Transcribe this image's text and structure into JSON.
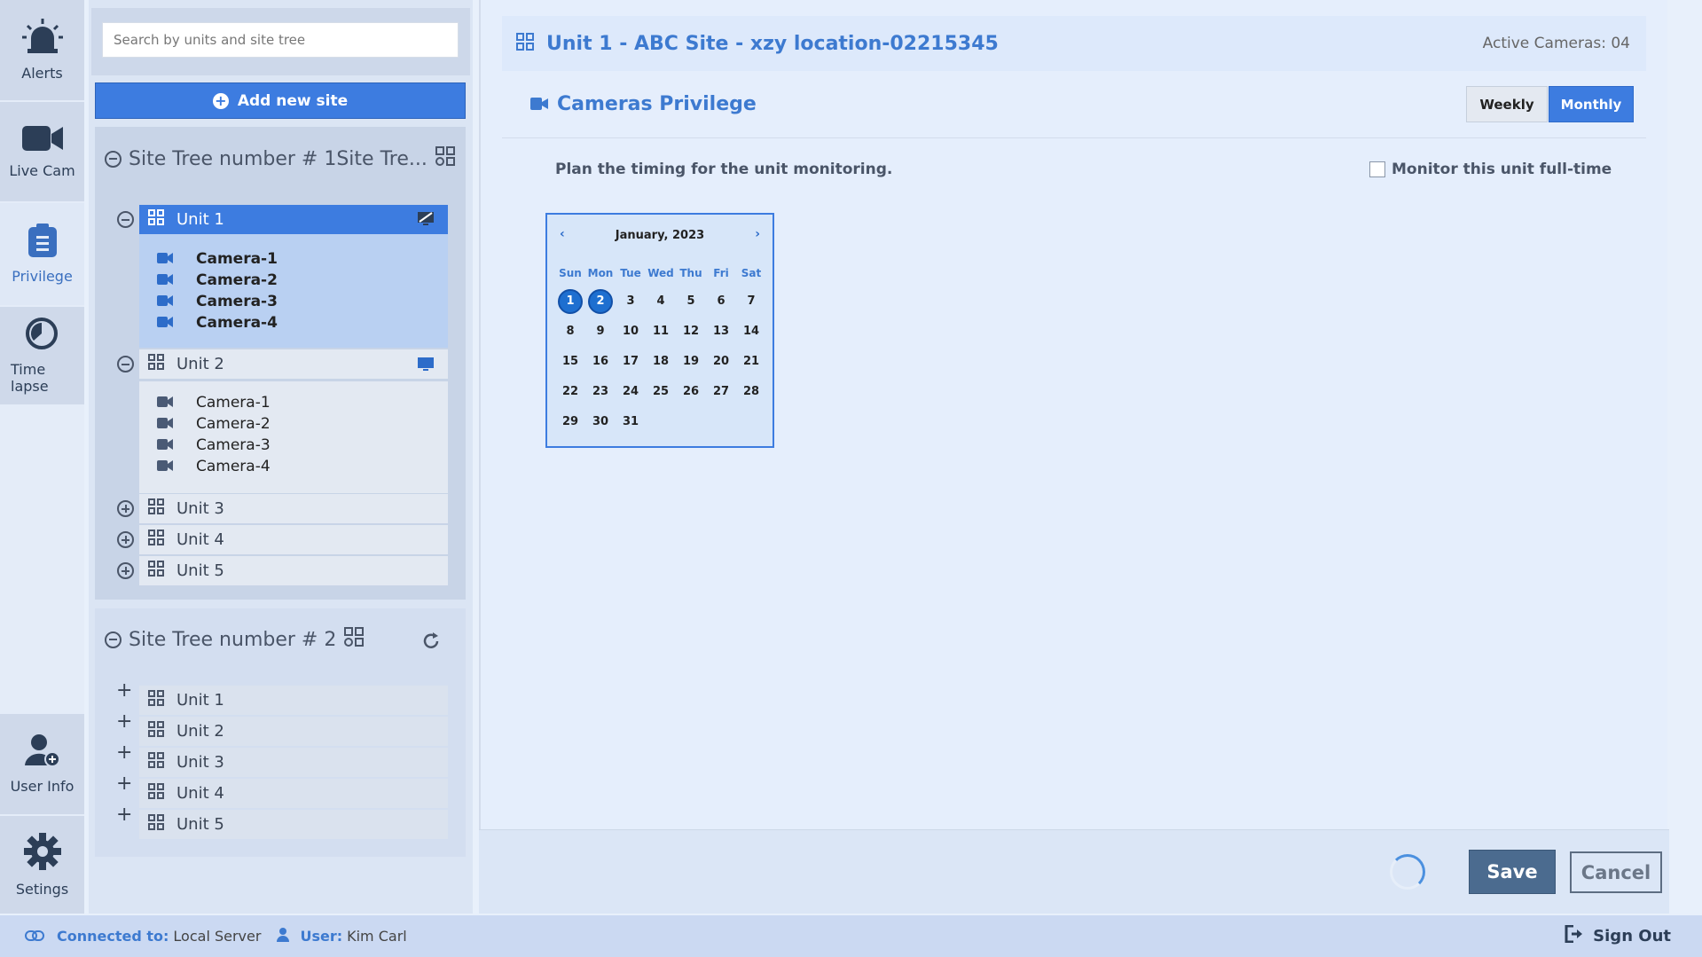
{
  "nav": {
    "alerts": "Alerts",
    "live_cam": "Live Cam",
    "privilege": "Privilege",
    "timelapse_1": "Time",
    "timelapse_2": "lapse",
    "user_info": "User Info",
    "settings": "Setings"
  },
  "sidebar": {
    "search_placeholder": "Search by units and site tree",
    "add_site_label": "Add new site",
    "tree1": {
      "title": "Site Tree number # 1Site Tre...",
      "units": [
        {
          "label": "Unit 1",
          "cameras": [
            "Camera-1",
            "Camera-2",
            "Camera-3",
            "Camera-4"
          ]
        },
        {
          "label": "Unit 2",
          "cameras": [
            "Camera-1",
            "Camera-2",
            "Camera-3",
            "Camera-4"
          ]
        },
        {
          "label": "Unit 3"
        },
        {
          "label": "Unit 4"
        },
        {
          "label": "Unit 5"
        }
      ]
    },
    "tree2": {
      "title": "Site Tree number # 2",
      "units": [
        {
          "label": "Unit 1"
        },
        {
          "label": "Unit 2"
        },
        {
          "label": "Unit 3"
        },
        {
          "label": "Unit 4"
        },
        {
          "label": "Unit 5"
        }
      ]
    }
  },
  "main": {
    "title": "Unit 1 - ABC Site - xzy location-02215345",
    "active_cameras": "Active Cameras: 04",
    "section_title": "Cameras Privilege",
    "weekly_label": "Weekly",
    "monthly_label": "Monthly",
    "plan_text": "Plan the timing for the unit monitoring.",
    "monitor_label": "Monitor this unit full-time",
    "calendar": {
      "month_label": "January, 2023",
      "prev": "‹",
      "next": "›",
      "weekdays": [
        "Sun",
        "Mon",
        "Tue",
        "Wed",
        "Thu",
        "Fri",
        "Sat"
      ],
      "days": [
        "1",
        "2",
        "3",
        "4",
        "5",
        "6",
        "7",
        "8",
        "9",
        "10",
        "11",
        "12",
        "13",
        "14",
        "15",
        "16",
        "17",
        "18",
        "19",
        "20",
        "21",
        "22",
        "23",
        "24",
        "25",
        "26",
        "27",
        "28",
        "29",
        "30",
        "31"
      ],
      "selected_days": [
        "1",
        "2"
      ]
    },
    "save_label": "Save",
    "cancel_label": "Cancel"
  },
  "status": {
    "connected_label": "Connected to:",
    "connected_value": "Local Server",
    "user_label": "User:",
    "user_value": "Kim Carl",
    "signout_label": "Sign Out"
  },
  "colors": {
    "accent": "#3d7ce0",
    "selected_day": "#1e6fd0"
  }
}
